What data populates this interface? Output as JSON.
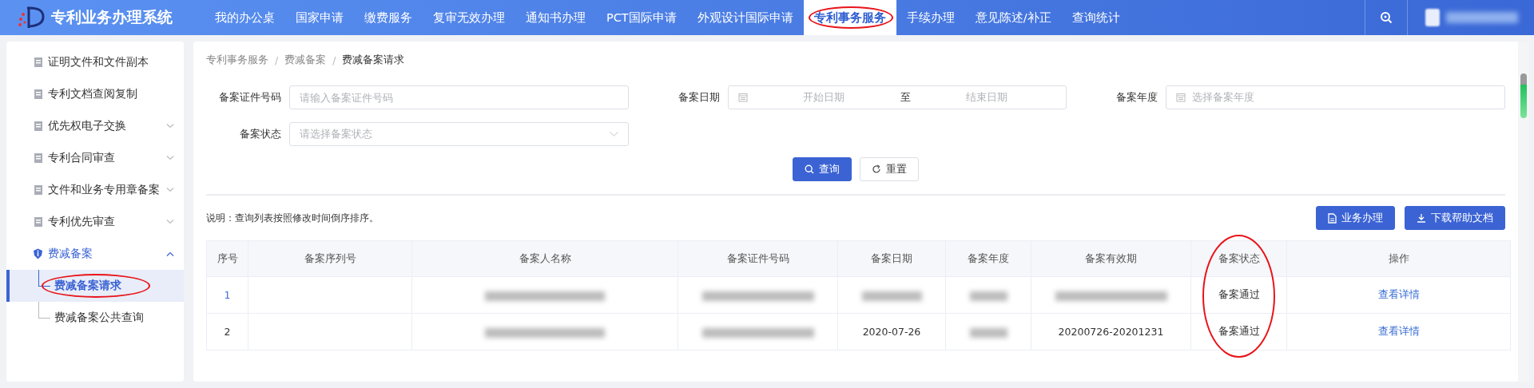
{
  "header": {
    "title": "专利业务办理系统",
    "nav": [
      {
        "label": "我的办公桌",
        "selected": false
      },
      {
        "label": "国家申请",
        "selected": false
      },
      {
        "label": "缴费服务",
        "selected": false
      },
      {
        "label": "复审无效办理",
        "selected": false
      },
      {
        "label": "通知书办理",
        "selected": false
      },
      {
        "label": "PCT国际申请",
        "selected": false
      },
      {
        "label": "外观设计国际申请",
        "selected": false
      },
      {
        "label": "专利事务服务",
        "selected": true,
        "circled": true
      },
      {
        "label": "手续办理",
        "selected": false
      },
      {
        "label": "意见陈述/补正",
        "selected": false
      },
      {
        "label": "查询统计",
        "selected": false
      }
    ]
  },
  "sidebar": {
    "items": [
      {
        "label": "证明文件和文件副本",
        "selected": false
      },
      {
        "label": "专利文档查阅复制",
        "selected": false
      },
      {
        "label": "优先权电子交换",
        "selected": false,
        "expanded": false
      },
      {
        "label": "专利合同审查",
        "selected": false,
        "expanded": false
      },
      {
        "label": "文件和业务专用章备案",
        "selected": false,
        "expanded": false
      },
      {
        "label": "专利优先审查",
        "selected": false,
        "expanded": false
      },
      {
        "label": "费减备案",
        "selected": true,
        "expanded": true,
        "children": [
          {
            "label": "费减备案请求",
            "selected": true,
            "circled": true
          },
          {
            "label": "费减备案公共查询",
            "selected": false
          }
        ]
      }
    ]
  },
  "breadcrumb": {
    "separator": "/",
    "items": [
      "专利事务服务",
      "费减备案",
      "费减备案请求"
    ]
  },
  "form": {
    "fields": [
      {
        "kind": "text",
        "label": "备案证件号码",
        "placeholder": "请输入备案证件号码"
      },
      {
        "kind": "daterange",
        "label": "备案日期",
        "start_placeholder": "开始日期",
        "separator": "至",
        "end_placeholder": "结束日期"
      },
      {
        "kind": "year",
        "label": "备案年度",
        "placeholder": "选择备案年度"
      },
      {
        "kind": "select",
        "label": "备案状态",
        "placeholder": "请选择备案状态"
      }
    ],
    "buttons": [
      {
        "kind": "primary",
        "label": "查询"
      },
      {
        "kind": "reset",
        "label": "重置"
      }
    ]
  },
  "note": "说明：查询列表按照修改时间倒序排序。",
  "actions": [
    {
      "kind": "document",
      "label": "业务办理"
    },
    {
      "kind": "download",
      "label": "下载帮助文档"
    }
  ],
  "table": {
    "columns": [
      {
        "label": "序号"
      },
      {
        "label": "备案序列号"
      },
      {
        "label": "备案人名称"
      },
      {
        "label": "备案证件号码"
      },
      {
        "label": "备案日期"
      },
      {
        "label": "备案年度"
      },
      {
        "label": "备案有效期"
      },
      {
        "label": "备案状态",
        "circled": true
      },
      {
        "label": "操作"
      }
    ],
    "rows": [
      [
        {
          "kind": "link",
          "text": "1"
        },
        {
          "kind": "empty"
        },
        {
          "kind": "blurred"
        },
        {
          "kind": "blurred"
        },
        {
          "kind": "blurred"
        },
        {
          "kind": "blurred"
        },
        {
          "kind": "blurred"
        },
        {
          "kind": "text",
          "text": "备案通过"
        },
        {
          "kind": "link",
          "text": "查看详情"
        }
      ],
      [
        {
          "kind": "text",
          "text": "2"
        },
        {
          "kind": "empty"
        },
        {
          "kind": "blurred"
        },
        {
          "kind": "blurred"
        },
        {
          "kind": "text",
          "text": "2020-07-26"
        },
        {
          "kind": "blurred"
        },
        {
          "kind": "text",
          "text": "20200726-20201231"
        },
        {
          "kind": "text",
          "text": "备案通过"
        },
        {
          "kind": "link",
          "text": "查看详情"
        }
      ]
    ]
  }
}
